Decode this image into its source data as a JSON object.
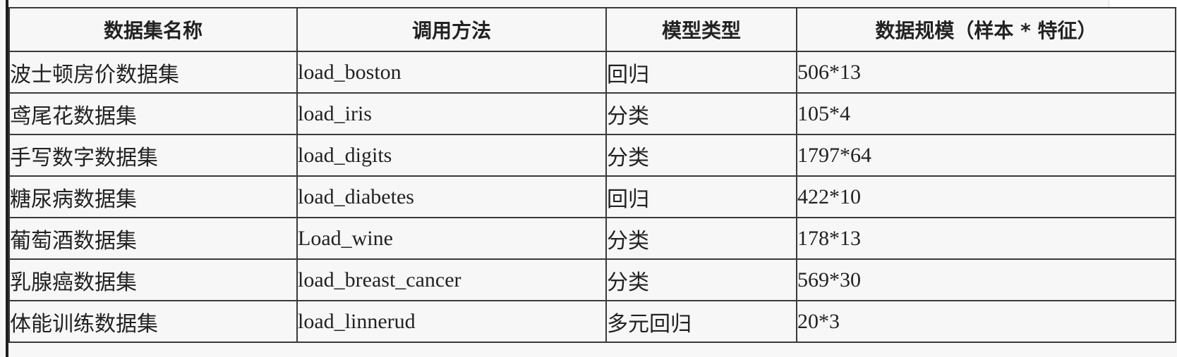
{
  "table": {
    "headers": [
      "数据集名称",
      "调用方法",
      "模型类型",
      "数据规模（样本 * 特征）"
    ],
    "rows": [
      {
        "name": "波士顿房价数据集",
        "method": "load_boston",
        "type": "回归",
        "scale": "506*13"
      },
      {
        "name": "鸢尾花数据集",
        "method": "load_iris",
        "type": "分类",
        "scale": "105*4"
      },
      {
        "name": "手写数字数据集",
        "method": "load_digits",
        "type": "分类",
        "scale": "1797*64"
      },
      {
        "name": "糖尿病数据集",
        "method": "load_diabetes",
        "type": "回归",
        "scale": "422*10"
      },
      {
        "name": "葡萄酒数据集",
        "method": "Load_wine",
        "type": "分类",
        "scale": "178*13"
      },
      {
        "name": "乳腺癌数据集",
        "method": "load_breast_cancer",
        "type": "分类",
        "scale": "569*30"
      },
      {
        "name": "体能训练数据集",
        "method": "load_linnerud",
        "type": "多元回归",
        "scale": "20*3"
      }
    ]
  }
}
